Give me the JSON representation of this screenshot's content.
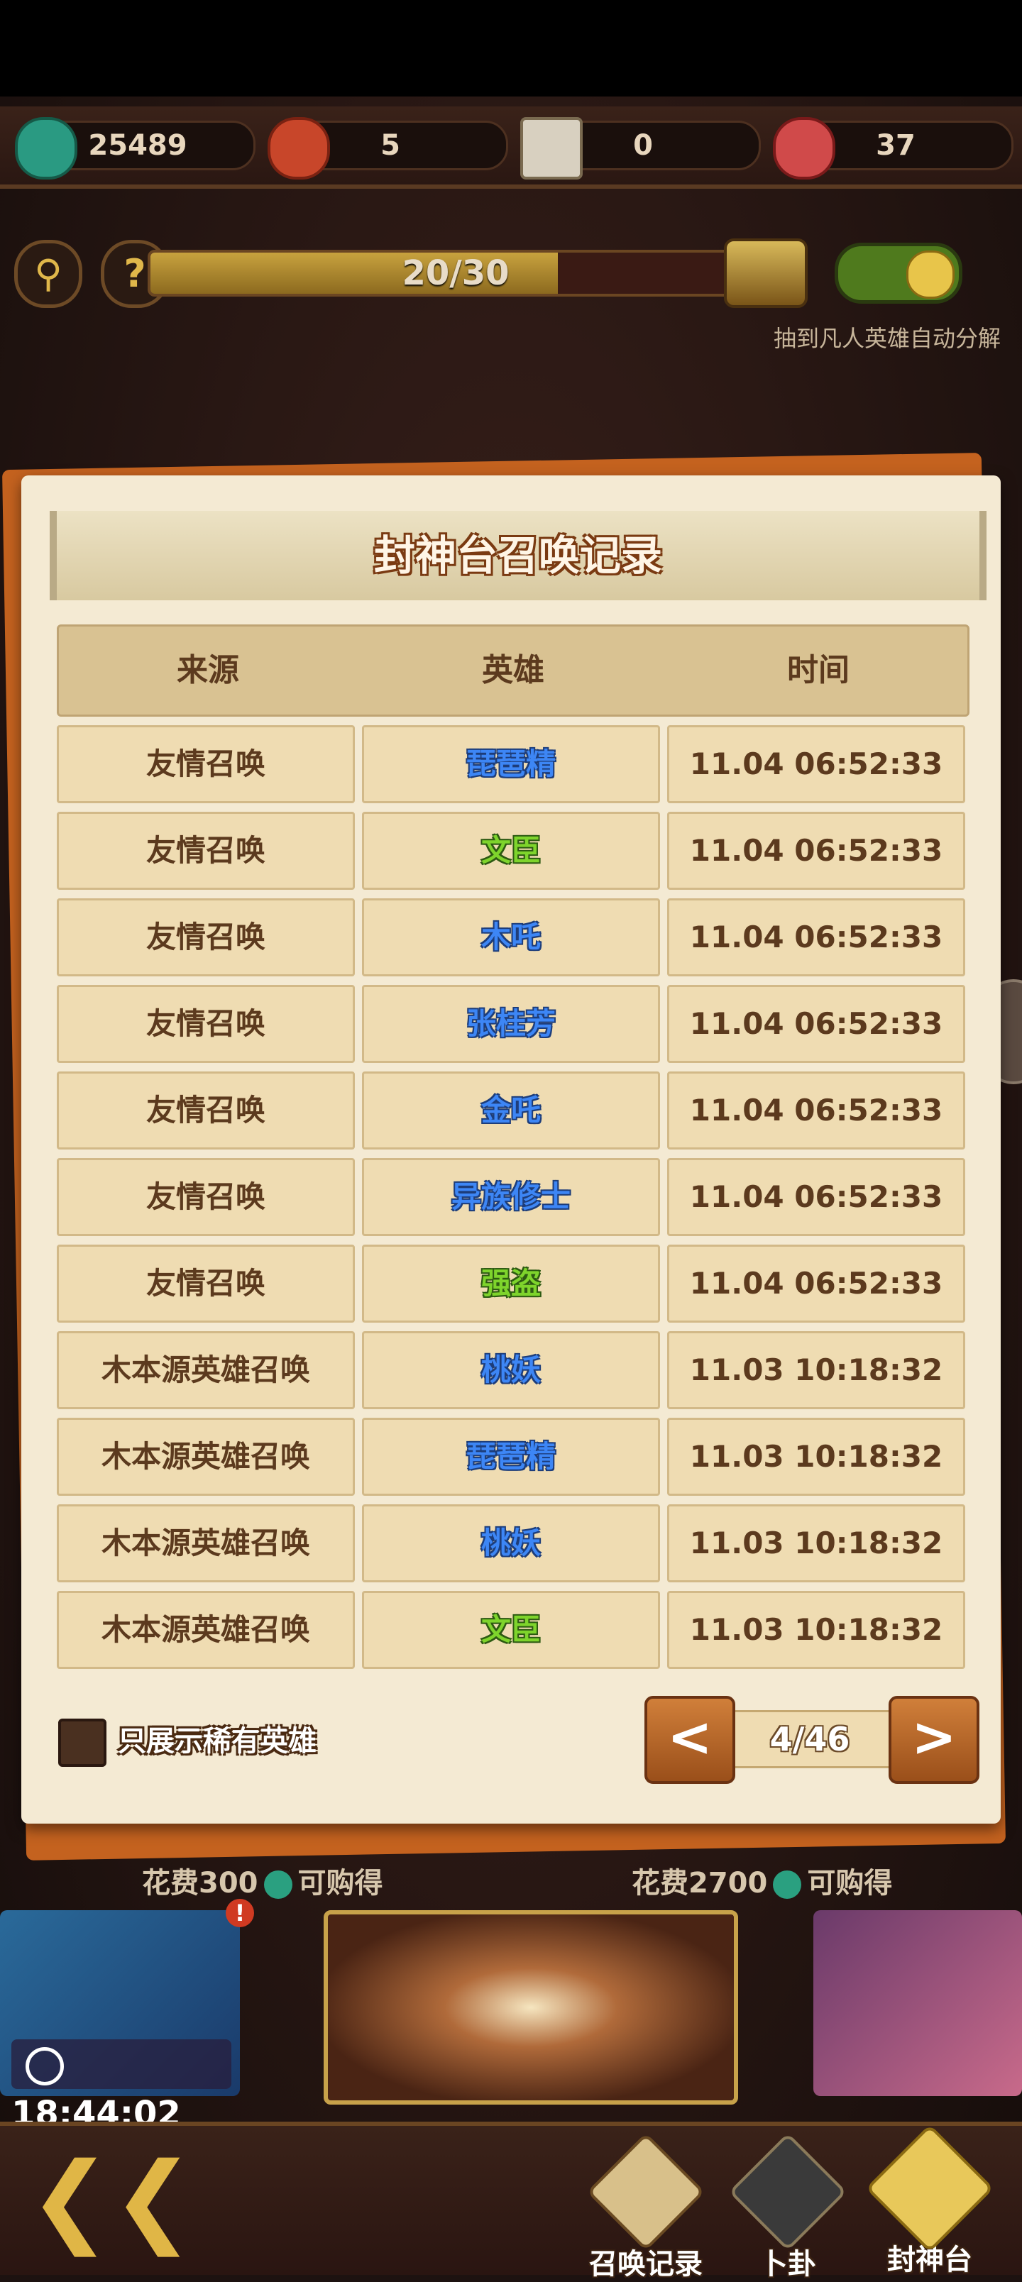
{
  "resources": [
    {
      "icon": "jade-coin-icon",
      "value": "25489"
    },
    {
      "icon": "hero-token-icon",
      "value": "5"
    },
    {
      "icon": "ticket-icon",
      "value": "0"
    },
    {
      "icon": "heart-icon",
      "value": "37"
    }
  ],
  "progress": {
    "text": "20/30",
    "fraction": 0.667
  },
  "auto_decompose_label": "抽到凡人英雄自动分解",
  "modal": {
    "title": "封神台召唤记录",
    "headers": [
      "来源",
      "英雄",
      "时间"
    ],
    "rows": [
      {
        "source": "友情召唤",
        "hero": "琵琶精",
        "hero_color": "blue",
        "time": "11.04 06:52:33"
      },
      {
        "source": "友情召唤",
        "hero": "文臣",
        "hero_color": "green",
        "time": "11.04 06:52:33"
      },
      {
        "source": "友情召唤",
        "hero": "木吒",
        "hero_color": "blue",
        "time": "11.04 06:52:33"
      },
      {
        "source": "友情召唤",
        "hero": "张桂芳",
        "hero_color": "blue",
        "time": "11.04 06:52:33"
      },
      {
        "source": "友情召唤",
        "hero": "金吒",
        "hero_color": "blue",
        "time": "11.04 06:52:33"
      },
      {
        "source": "友情召唤",
        "hero": "异族修士",
        "hero_color": "blue",
        "time": "11.04 06:52:33"
      },
      {
        "source": "友情召唤",
        "hero": "强盗",
        "hero_color": "green",
        "time": "11.04 06:52:33"
      },
      {
        "source": "木本源英雄召唤",
        "hero": "桃妖",
        "hero_color": "blue",
        "time": "11.03 10:18:32"
      },
      {
        "source": "木本源英雄召唤",
        "hero": "琵琶精",
        "hero_color": "blue",
        "time": "11.03 10:18:32"
      },
      {
        "source": "木本源英雄召唤",
        "hero": "桃妖",
        "hero_color": "blue",
        "time": "11.03 10:18:32"
      },
      {
        "source": "木本源英雄召唤",
        "hero": "文臣",
        "hero_color": "green",
        "time": "11.03 10:18:32"
      }
    ],
    "rare_only_label": "只展示稀有英雄",
    "pager": {
      "prev": "<",
      "page": "4/46",
      "next": ">"
    }
  },
  "costs": [
    {
      "label_before": "花费300",
      "label_after": "可购得"
    },
    {
      "label_before": "花费2700",
      "label_after": "可购得"
    }
  ],
  "timer": "18:44:02",
  "badge": "!",
  "nav": [
    {
      "label": "召唤记录",
      "icon": "scroll-record-icon"
    },
    {
      "label": "卜卦",
      "icon": "bagua-icon"
    },
    {
      "label": "封神台",
      "icon": "altar-icon"
    }
  ],
  "colors": {
    "modal_bg": "#f4ead3",
    "hero_blue": "#3d86f5",
    "hero_green": "#7ed42c",
    "accent_orange": "#c4621f"
  }
}
